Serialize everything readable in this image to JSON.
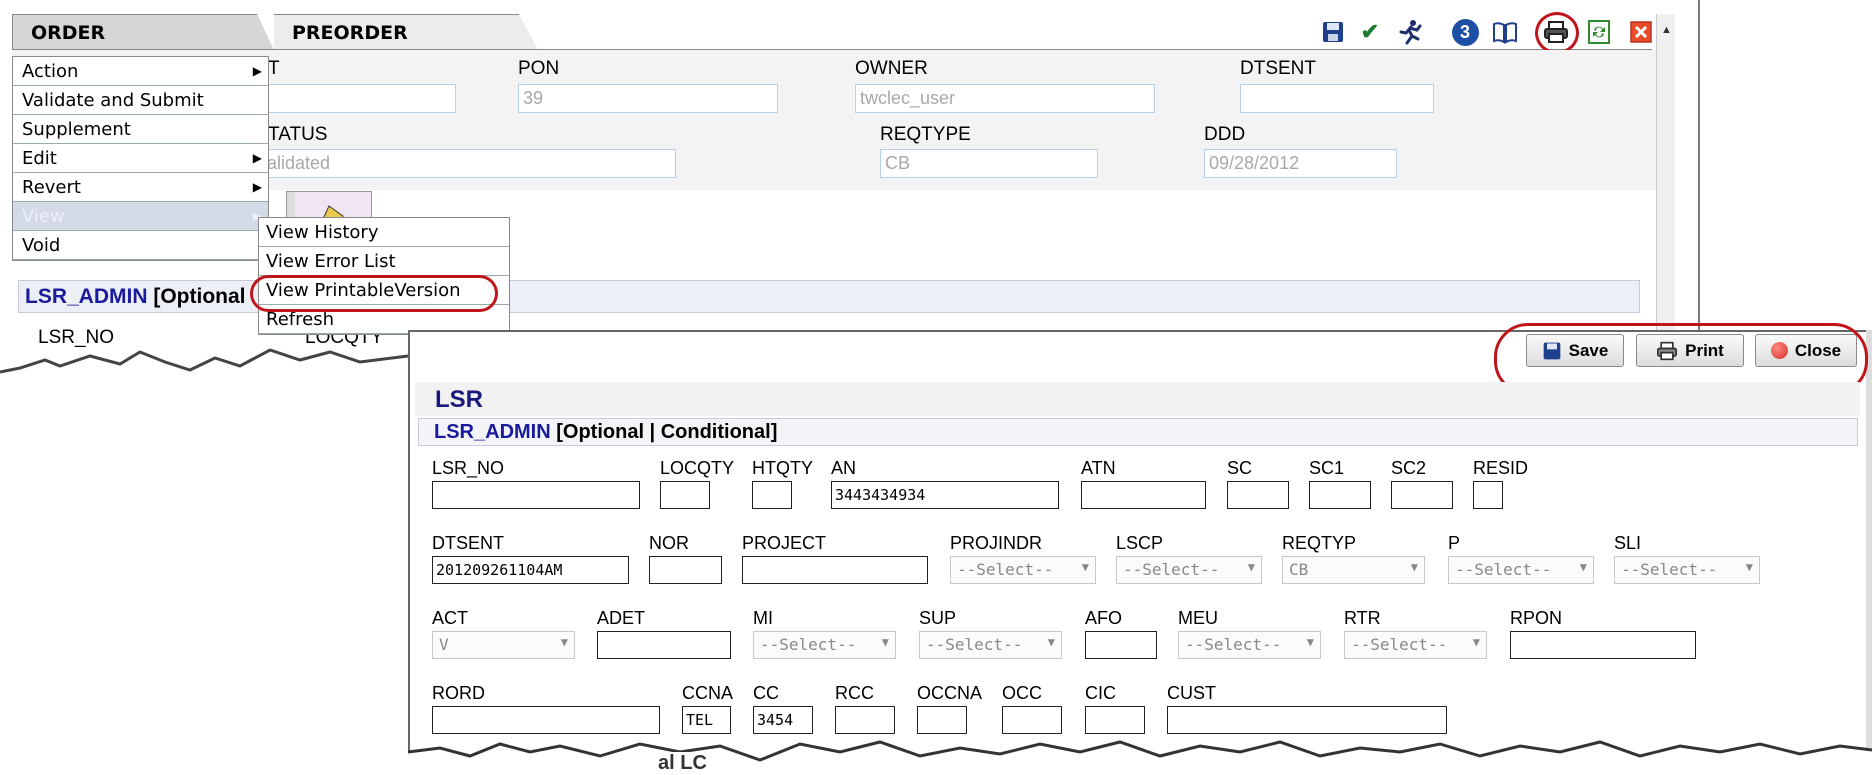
{
  "tabs": [
    {
      "label": "ORDER"
    },
    {
      "label": "PREORDER"
    }
  ],
  "toolbar_icons": [
    "save-icon",
    "checkmark-icon",
    "runner-icon",
    "number-3-icon",
    "book-icon",
    "printer-icon",
    "refresh-icon",
    "close-icon"
  ],
  "toolbar_badge": "3",
  "header": {
    "t_label": "T",
    "pon_label": "PON",
    "pon_value": "39",
    "owner_label": "OWNER",
    "owner_value": "twclec_user",
    "dtsent_label": "DTSENT",
    "dtsent_value": "",
    "status_label": "TATUS",
    "status_value": "alidated",
    "reqtype_label": "REQTYPE",
    "reqtype_value": "CB",
    "ddd_label": "DDD",
    "ddd_value": "09/28/2012"
  },
  "menu": {
    "items": [
      {
        "label": "Action",
        "has_sub": true
      },
      {
        "label": "Validate and Submit",
        "has_sub": false
      },
      {
        "label": "Supplement",
        "has_sub": false
      },
      {
        "label": "Edit",
        "has_sub": true
      },
      {
        "label": "Revert",
        "has_sub": true
      },
      {
        "label": "View",
        "has_sub": true,
        "disabled": true
      },
      {
        "label": "Void",
        "has_sub": false
      }
    ],
    "submenu": [
      "View History",
      "View Error List",
      "View PrintableVersion",
      "Refresh"
    ]
  },
  "back_section": {
    "title": "LSR_ADMIN",
    "suffix": "[Optional",
    "field1": "LSR_NO",
    "field2": "LOCQTY"
  },
  "front": {
    "buttons": {
      "save": "Save",
      "print": "Print",
      "close": "Close"
    },
    "title": "LSR",
    "subtitle": "LSR_ADMIN",
    "subtitle_suffix": "[Optional | Conditional]",
    "select_placeholder": "--Select--",
    "fields": {
      "lsr_no": {
        "label": "LSR_NO",
        "value": ""
      },
      "locqty": {
        "label": "LOCQTY",
        "value": ""
      },
      "htqty": {
        "label": "HTQTY",
        "value": ""
      },
      "an": {
        "label": "AN",
        "value": "3443434934"
      },
      "atn": {
        "label": "ATN",
        "value": ""
      },
      "sc": {
        "label": "SC",
        "value": ""
      },
      "sc1": {
        "label": "SC1",
        "value": ""
      },
      "sc2": {
        "label": "SC2",
        "value": ""
      },
      "resid": {
        "label": "RESID",
        "value": ""
      },
      "dtsent": {
        "label": "DTSENT",
        "value": "201209261104AM"
      },
      "nor": {
        "label": "NOR",
        "value": ""
      },
      "project": {
        "label": "PROJECT",
        "value": ""
      },
      "projindr": {
        "label": "PROJINDR",
        "value": "--Select--"
      },
      "lscp": {
        "label": "LSCP",
        "value": "--Select--"
      },
      "reqtyp": {
        "label": "REQTYP",
        "value": "CB"
      },
      "p": {
        "label": "P",
        "value": "--Select--"
      },
      "sli": {
        "label": "SLI",
        "value": "--Select--"
      },
      "act": {
        "label": "ACT",
        "value": "V"
      },
      "adet": {
        "label": "ADET",
        "value": ""
      },
      "mi": {
        "label": "MI",
        "value": "--Select--"
      },
      "sup": {
        "label": "SUP",
        "value": "--Select--"
      },
      "afo": {
        "label": "AFO",
        "value": ""
      },
      "meu": {
        "label": "MEU",
        "value": "--Select--"
      },
      "rtr": {
        "label": "RTR",
        "value": "--Select--"
      },
      "rpon": {
        "label": "RPON",
        "value": ""
      },
      "rord": {
        "label": "RORD",
        "value": ""
      },
      "ccna": {
        "label": "CCNA",
        "value": "TEL"
      },
      "cc": {
        "label": "CC",
        "value": "3454"
      },
      "rcc": {
        "label": "RCC",
        "value": ""
      },
      "occna": {
        "label": "OCCNA",
        "value": ""
      },
      "occ": {
        "label": "OCC",
        "value": ""
      },
      "cic": {
        "label": "CIC",
        "value": ""
      },
      "cust": {
        "label": "CUST",
        "value": ""
      }
    },
    "bottom_fragment": "al LC"
  },
  "colors": {
    "highlight_circle": "#c0151b",
    "title_blue": "#1a1a9c"
  }
}
